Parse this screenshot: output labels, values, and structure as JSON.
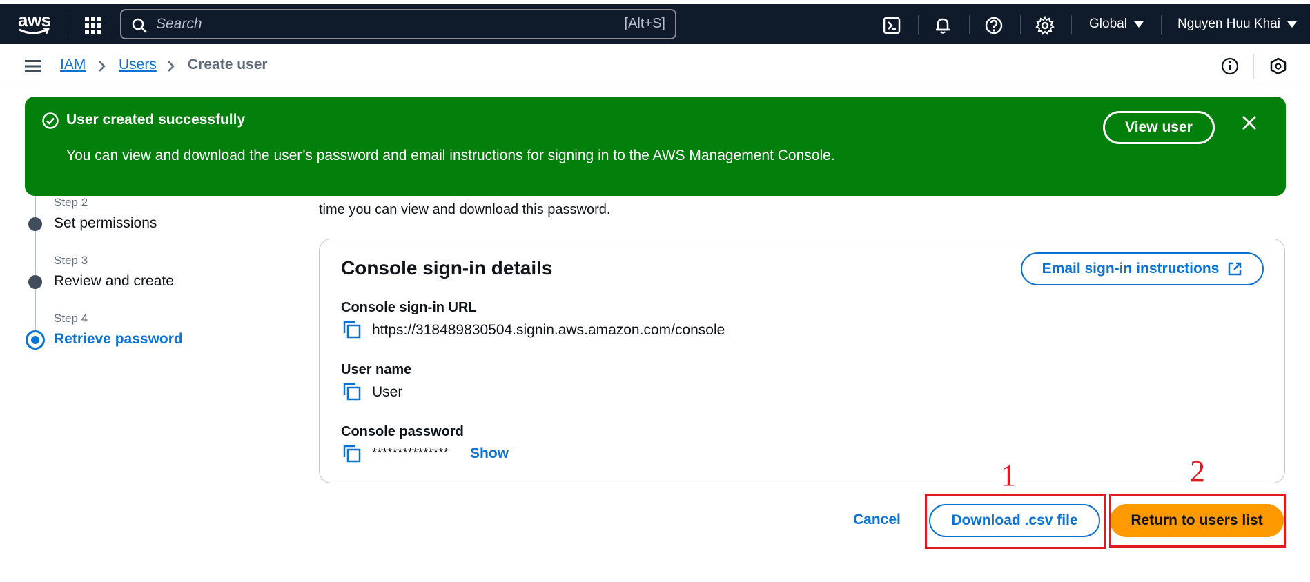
{
  "topbar": {
    "logo": "aws",
    "search_placeholder": "Search",
    "search_shortcut": "[Alt+S]",
    "region": "Global",
    "user": "Nguyen Huu Khai",
    "icons": [
      "apps-grid-icon",
      "cloudshell-icon",
      "bell-icon",
      "help-icon",
      "gear-icon"
    ]
  },
  "breadcrumb": {
    "items": [
      "IAM",
      "Users"
    ],
    "current": "Create user"
  },
  "banner": {
    "title": "User created successfully",
    "body": "You can view and download the user’s password and email instructions for signing in to the AWS Management Console.",
    "view_button": "View user"
  },
  "steps": [
    {
      "label": "Step 2",
      "title": "Set permissions"
    },
    {
      "label": "Step 3",
      "title": "Review and create"
    },
    {
      "label": "Step 4",
      "title": "Retrieve password"
    }
  ],
  "partial_text": "time you can view and download this password.",
  "card": {
    "title": "Console sign-in details",
    "email_button": "Email sign-in instructions",
    "fields": [
      {
        "label": "Console sign-in URL",
        "value": "https://318489830504.signin.aws.amazon.com/console"
      },
      {
        "label": "User name",
        "value": "User"
      },
      {
        "label": "Console password",
        "value": "***************",
        "action": "Show"
      }
    ]
  },
  "actions": {
    "cancel": "Cancel",
    "download": "Download .csv file",
    "return": "Return to users list"
  },
  "annotations": [
    "1",
    "2"
  ],
  "colors": {
    "topbar_bg": "#0f1b2a",
    "success_green": "#037f0c",
    "link_blue": "#0972d3",
    "primary_orange": "#ff9900",
    "annotation_red": "#e0181f"
  }
}
